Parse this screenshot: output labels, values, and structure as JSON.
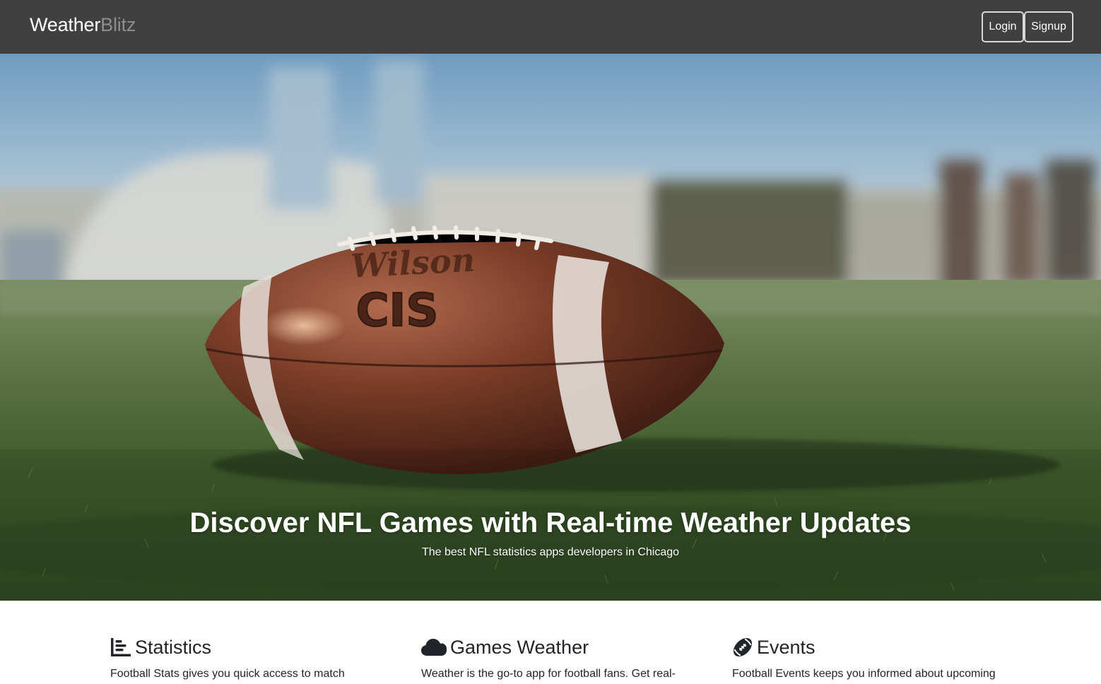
{
  "navbar": {
    "brand_primary": "Weather",
    "brand_secondary": "Blitz",
    "login_label": "Login",
    "signup_label": "Signup"
  },
  "hero": {
    "title": "Discover NFL Games with Real-time Weather Updates",
    "subtitle": "The best NFL statistics apps developers in Chicago",
    "ball_brand": "Wilson",
    "ball_mark": "CIS"
  },
  "features": [
    {
      "icon": "bar-chart-icon",
      "title": "Statistics",
      "text": "Football Stats gives you quick access to match"
    },
    {
      "icon": "cloud-icon",
      "title": "Games Weather",
      "text": "Weather is the go-to app for football fans. Get real-"
    },
    {
      "icon": "football-icon",
      "title": "Events",
      "text": "Football Events keeps you informed about upcoming"
    }
  ],
  "colors": {
    "navbar_bg": "#404040",
    "brand_secondary": "#8e8e8e",
    "text_dark": "#212529"
  }
}
